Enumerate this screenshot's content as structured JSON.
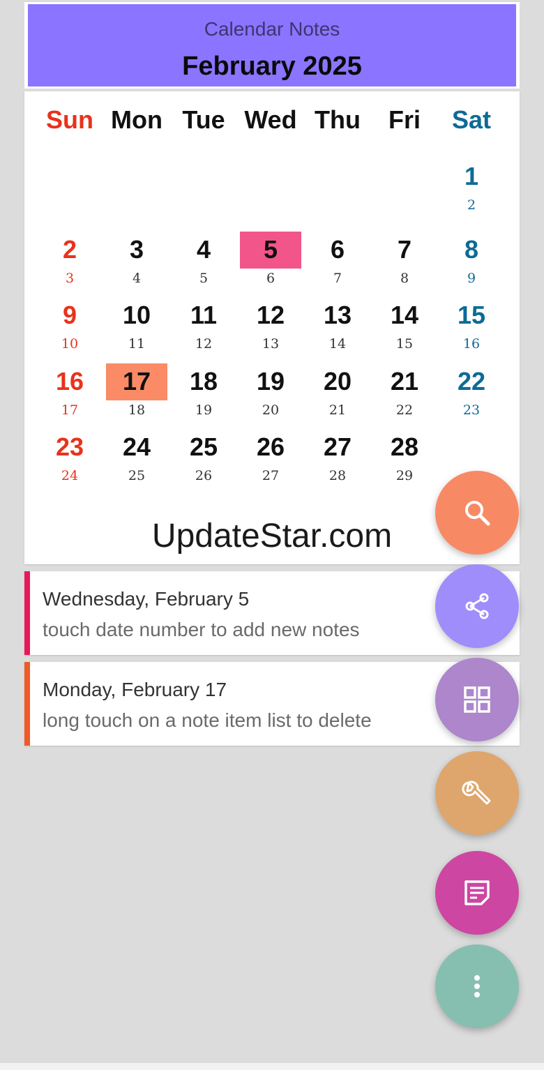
{
  "header": {
    "app_title": "Calendar Notes",
    "month_title": "February 2025"
  },
  "weekdays": [
    {
      "label": "Sun",
      "color": "#e8321c"
    },
    {
      "label": "Mon",
      "color": "#111111"
    },
    {
      "label": "Tue",
      "color": "#111111"
    },
    {
      "label": "Wed",
      "color": "#111111"
    },
    {
      "label": "Thu",
      "color": "#111111"
    },
    {
      "label": "Fri",
      "color": "#111111"
    },
    {
      "label": "Sat",
      "color": "#0e6a96"
    }
  ],
  "days": [
    {
      "num": "1",
      "sub": "2"
    },
    {
      "num": "2",
      "sub": "3"
    },
    {
      "num": "3",
      "sub": "4"
    },
    {
      "num": "4",
      "sub": "5"
    },
    {
      "num": "5",
      "sub": "6",
      "highlight": "#f2558a"
    },
    {
      "num": "6",
      "sub": "7"
    },
    {
      "num": "7",
      "sub": "8"
    },
    {
      "num": "8",
      "sub": "9"
    },
    {
      "num": "9",
      "sub": "10"
    },
    {
      "num": "10",
      "sub": "11"
    },
    {
      "num": "11",
      "sub": "12"
    },
    {
      "num": "12",
      "sub": "13"
    },
    {
      "num": "13",
      "sub": "14"
    },
    {
      "num": "14",
      "sub": "15"
    },
    {
      "num": "15",
      "sub": "16"
    },
    {
      "num": "16",
      "sub": "17"
    },
    {
      "num": "17",
      "sub": "18",
      "highlight": "#fa8b66"
    },
    {
      "num": "18",
      "sub": "19"
    },
    {
      "num": "19",
      "sub": "20"
    },
    {
      "num": "20",
      "sub": "21"
    },
    {
      "num": "21",
      "sub": "22"
    },
    {
      "num": "22",
      "sub": "23"
    },
    {
      "num": "23",
      "sub": "24"
    },
    {
      "num": "24",
      "sub": "25"
    },
    {
      "num": "25",
      "sub": "26"
    },
    {
      "num": "26",
      "sub": "27"
    },
    {
      "num": "27",
      "sub": "28"
    },
    {
      "num": "28",
      "sub": "29"
    }
  ],
  "watermark": "UpdateStar.com",
  "notes": [
    {
      "date": "Wednesday, February 5",
      "text": "touch date number to add new notes",
      "color": "#e8195a"
    },
    {
      "date": "Monday, February 17",
      "text": "long touch on a note item list to delete",
      "color": "#f05a28"
    }
  ],
  "fabs": [
    {
      "name": "search-fab",
      "icon": "search-icon",
      "color": "#f78a64"
    },
    {
      "name": "share-fab",
      "icon": "share-icon",
      "color": "#9e8dfb"
    },
    {
      "name": "grid-fab",
      "icon": "grid-icon",
      "color": "#ad86cc"
    },
    {
      "name": "settings-fab",
      "icon": "wrench-icon",
      "color": "#dea66c"
    },
    {
      "name": "notes-fab",
      "icon": "note-icon",
      "color": "#cd46a2"
    },
    {
      "name": "more-fab",
      "icon": "more-vertical-icon",
      "color": "#86bfb0"
    }
  ],
  "colors": {
    "sunday": "#e8321c",
    "saturday": "#0e6a96",
    "weekday": "#111111",
    "header_bg": "#8b74ff"
  }
}
